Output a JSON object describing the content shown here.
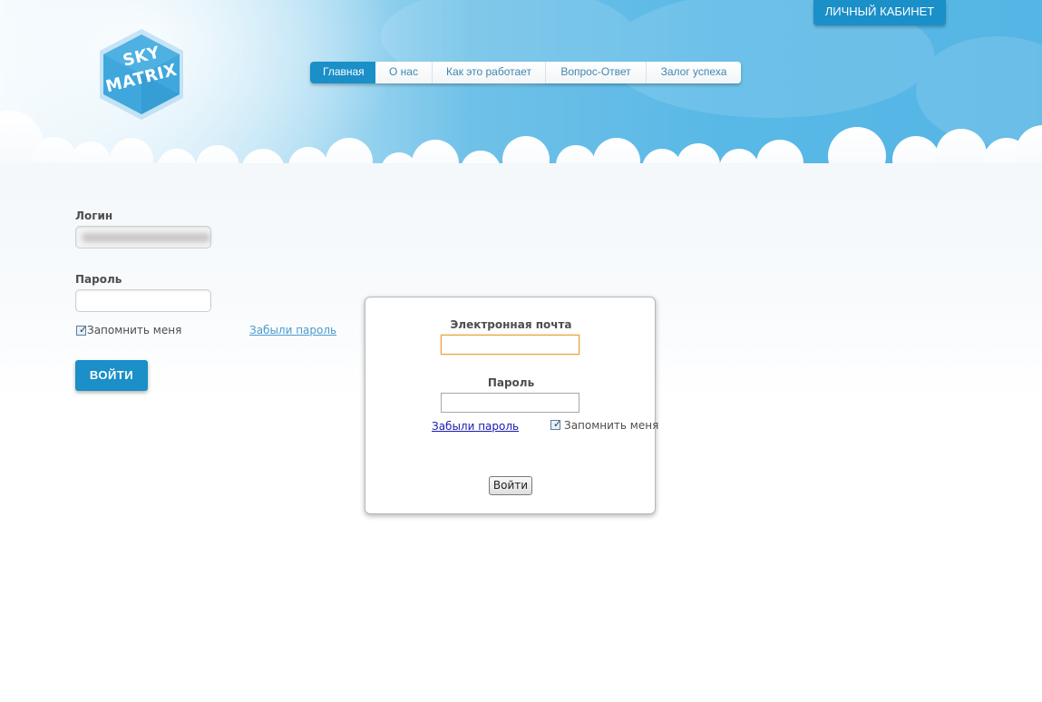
{
  "header": {
    "cabinet_label": "ЛИЧНЫЙ КАБИНЕТ",
    "logo_line1": "SKY",
    "logo_line2": "MATRIX"
  },
  "nav": {
    "items": [
      {
        "label": "Главная",
        "active": true
      },
      {
        "label": "О нас",
        "active": false
      },
      {
        "label": "Как это работает",
        "active": false
      },
      {
        "label": "Вопрос-Ответ",
        "active": false
      },
      {
        "label": "Залог успеха",
        "active": false
      }
    ]
  },
  "login_form": {
    "login_label": "Логин",
    "login_value": "",
    "password_label": "Пароль",
    "password_value": "",
    "remember_label": "Запомнить меня",
    "remember_checked": true,
    "forgot_label": "Забыли пароль",
    "submit_label": "ВОЙТИ"
  },
  "modal": {
    "email_label": "Электронная почта",
    "email_value": "",
    "password_label": "Пароль",
    "password_value": "",
    "forgot_label": "Забыли пароль",
    "remember_label": "Запомнить меня",
    "remember_checked": true,
    "submit_label": "Войти"
  },
  "colors": {
    "accent": "#1a8fc8",
    "sky": "#58b8e6",
    "link": "#4a9bd0"
  },
  "icons": {
    "logo": "hexagon-logo-icon",
    "checkbox": "checkmark-icon"
  }
}
